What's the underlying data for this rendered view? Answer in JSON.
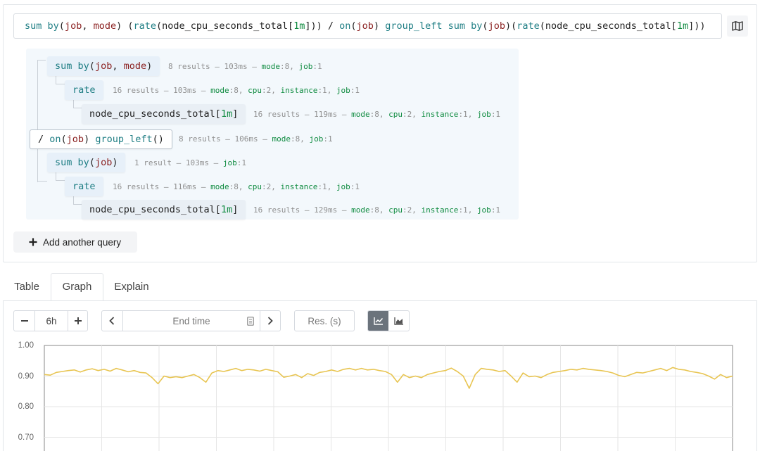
{
  "query": {
    "expression_tokens": [
      {
        "t": "sum",
        "c": "t-fn"
      },
      {
        "t": " ",
        "c": "t-plain"
      },
      {
        "t": "by",
        "c": "t-fn"
      },
      {
        "t": "(",
        "c": "t-plain"
      },
      {
        "t": "job",
        "c": "t-lbl"
      },
      {
        "t": ", ",
        "c": "t-plain"
      },
      {
        "t": "mode",
        "c": "t-lbl"
      },
      {
        "t": ") (",
        "c": "t-plain"
      },
      {
        "t": "rate",
        "c": "t-fn"
      },
      {
        "t": "(node_cpu_seconds_total[",
        "c": "t-plain"
      },
      {
        "t": "1m",
        "c": "t-num"
      },
      {
        "t": "])) / ",
        "c": "t-plain"
      },
      {
        "t": "on",
        "c": "t-fn"
      },
      {
        "t": "(",
        "c": "t-plain"
      },
      {
        "t": "job",
        "c": "t-lbl"
      },
      {
        "t": ") ",
        "c": "t-plain"
      },
      {
        "t": "group_left",
        "c": "t-fn"
      },
      {
        "t": " ",
        "c": "t-plain"
      },
      {
        "t": "sum",
        "c": "t-fn"
      },
      {
        "t": " ",
        "c": "t-plain"
      },
      {
        "t": "by",
        "c": "t-fn"
      },
      {
        "t": "(",
        "c": "t-plain"
      },
      {
        "t": "job",
        "c": "t-lbl"
      },
      {
        "t": ")(",
        "c": "t-plain"
      },
      {
        "t": "rate",
        "c": "t-fn"
      },
      {
        "t": "(node_cpu_seconds_total[",
        "c": "t-plain"
      },
      {
        "t": "1m",
        "c": "t-num"
      },
      {
        "t": "]))",
        "c": "t-plain"
      }
    ],
    "add_query_label": "Add another query"
  },
  "tree": [
    {
      "id": "n1",
      "tokens": [
        {
          "t": "sum",
          "c": "t-fn"
        },
        {
          "t": " ",
          "c": "t-plain"
        },
        {
          "t": "by",
          "c": "t-fn"
        },
        {
          "t": "(",
          "c": "t-plain"
        },
        {
          "t": "job",
          "c": "t-lbl"
        },
        {
          "t": ", ",
          "c": "t-plain"
        },
        {
          "t": "mode",
          "c": "t-lbl"
        },
        {
          "t": ")",
          "c": "t-plain"
        }
      ],
      "info": "8 results – 103ms – ",
      "labels": [
        [
          "mode",
          "8"
        ],
        [
          "job",
          "1"
        ]
      ]
    },
    {
      "id": "n2",
      "tokens": [
        {
          "t": "rate",
          "c": "t-fn"
        }
      ],
      "info": "16 results – 103ms – ",
      "labels": [
        [
          "mode",
          "8"
        ],
        [
          "cpu",
          "2"
        ],
        [
          "instance",
          "1"
        ],
        [
          "job",
          "1"
        ]
      ]
    },
    {
      "id": "n3",
      "tokens": [
        {
          "t": "node_cpu_seconds_total[",
          "c": "t-plain"
        },
        {
          "t": "1m",
          "c": "t-num"
        },
        {
          "t": "]",
          "c": "t-plain"
        }
      ],
      "info": "16 results – 119ms – ",
      "labels": [
        [
          "mode",
          "8"
        ],
        [
          "cpu",
          "2"
        ],
        [
          "instance",
          "1"
        ],
        [
          "job",
          "1"
        ]
      ]
    },
    {
      "id": "n4",
      "tokens": [
        {
          "t": "/ ",
          "c": "t-plain"
        },
        {
          "t": "on",
          "c": "t-fn"
        },
        {
          "t": "(",
          "c": "t-plain"
        },
        {
          "t": "job",
          "c": "t-lbl"
        },
        {
          "t": ") ",
          "c": "t-plain"
        },
        {
          "t": "group_left",
          "c": "t-fn"
        },
        {
          "t": "()",
          "c": "t-plain"
        }
      ],
      "info": "8 results – 106ms – ",
      "labels": [
        [
          "mode",
          "8"
        ],
        [
          "job",
          "1"
        ]
      ]
    },
    {
      "id": "n5",
      "tokens": [
        {
          "t": "sum",
          "c": "t-fn"
        },
        {
          "t": " ",
          "c": "t-plain"
        },
        {
          "t": "by",
          "c": "t-fn"
        },
        {
          "t": "(",
          "c": "t-plain"
        },
        {
          "t": "job",
          "c": "t-lbl"
        },
        {
          "t": ")",
          "c": "t-plain"
        }
      ],
      "info": "1 result – 103ms – ",
      "labels": [
        [
          "job",
          "1"
        ]
      ]
    },
    {
      "id": "n6",
      "tokens": [
        {
          "t": "rate",
          "c": "t-fn"
        }
      ],
      "info": "16 results – 116ms – ",
      "labels": [
        [
          "mode",
          "8"
        ],
        [
          "cpu",
          "2"
        ],
        [
          "instance",
          "1"
        ],
        [
          "job",
          "1"
        ]
      ]
    },
    {
      "id": "n7",
      "tokens": [
        {
          "t": "node_cpu_seconds_total[",
          "c": "t-plain"
        },
        {
          "t": "1m",
          "c": "t-num"
        },
        {
          "t": "]",
          "c": "t-plain"
        }
      ],
      "info": "16 results – 129ms – ",
      "labels": [
        [
          "mode",
          "8"
        ],
        [
          "cpu",
          "2"
        ],
        [
          "instance",
          "1"
        ],
        [
          "job",
          "1"
        ]
      ]
    }
  ],
  "tabs": [
    {
      "label": "Table",
      "active": false
    },
    {
      "label": "Graph",
      "active": true
    },
    {
      "label": "Explain",
      "active": false
    }
  ],
  "controls": {
    "range_value": "6h",
    "end_time_placeholder": "End time",
    "resolution_placeholder": "Res. (s)",
    "stacked": false
  },
  "chart_data": {
    "type": "line",
    "y_ticks": [
      "1.00",
      "0.90",
      "0.80",
      "0.70"
    ],
    "ylim": [
      0.68,
      1.0
    ],
    "grid": true,
    "series_color": "#e8c552",
    "series": [
      {
        "values": [
          0.905,
          0.903,
          0.912,
          0.915,
          0.918,
          0.92,
          0.913,
          0.92,
          0.924,
          0.918,
          0.922,
          0.916,
          0.925,
          0.92,
          0.914,
          0.918,
          0.912,
          0.91,
          0.895,
          0.875,
          0.9,
          0.895,
          0.898,
          0.895,
          0.9,
          0.905,
          0.895,
          0.88,
          0.91,
          0.918,
          0.915,
          0.92,
          0.925,
          0.918,
          0.922,
          0.92,
          0.916,
          0.922,
          0.918,
          0.914,
          0.896,
          0.9,
          0.905,
          0.895,
          0.908,
          0.902,
          0.912,
          0.915,
          0.92,
          0.915,
          0.922,
          0.925,
          0.92,
          0.925,
          0.92,
          0.922,
          0.918,
          0.915,
          0.905,
          0.88,
          0.905,
          0.895,
          0.9,
          0.895,
          0.905,
          0.91,
          0.915,
          0.918,
          0.926,
          0.915,
          0.9,
          0.86,
          0.905,
          0.925,
          0.922,
          0.92,
          0.915,
          0.918,
          0.9,
          0.88,
          0.91,
          0.898,
          0.9,
          0.895,
          0.905,
          0.912,
          0.915,
          0.918,
          0.922,
          0.92,
          0.925,
          0.922,
          0.92,
          0.918,
          0.915,
          0.91,
          0.902,
          0.898,
          0.905,
          0.912,
          0.91,
          0.915,
          0.92,
          0.925,
          0.918,
          0.928,
          0.922,
          0.92,
          0.915,
          0.912,
          0.908,
          0.9,
          0.89,
          0.905,
          0.895,
          0.9
        ]
      }
    ]
  }
}
